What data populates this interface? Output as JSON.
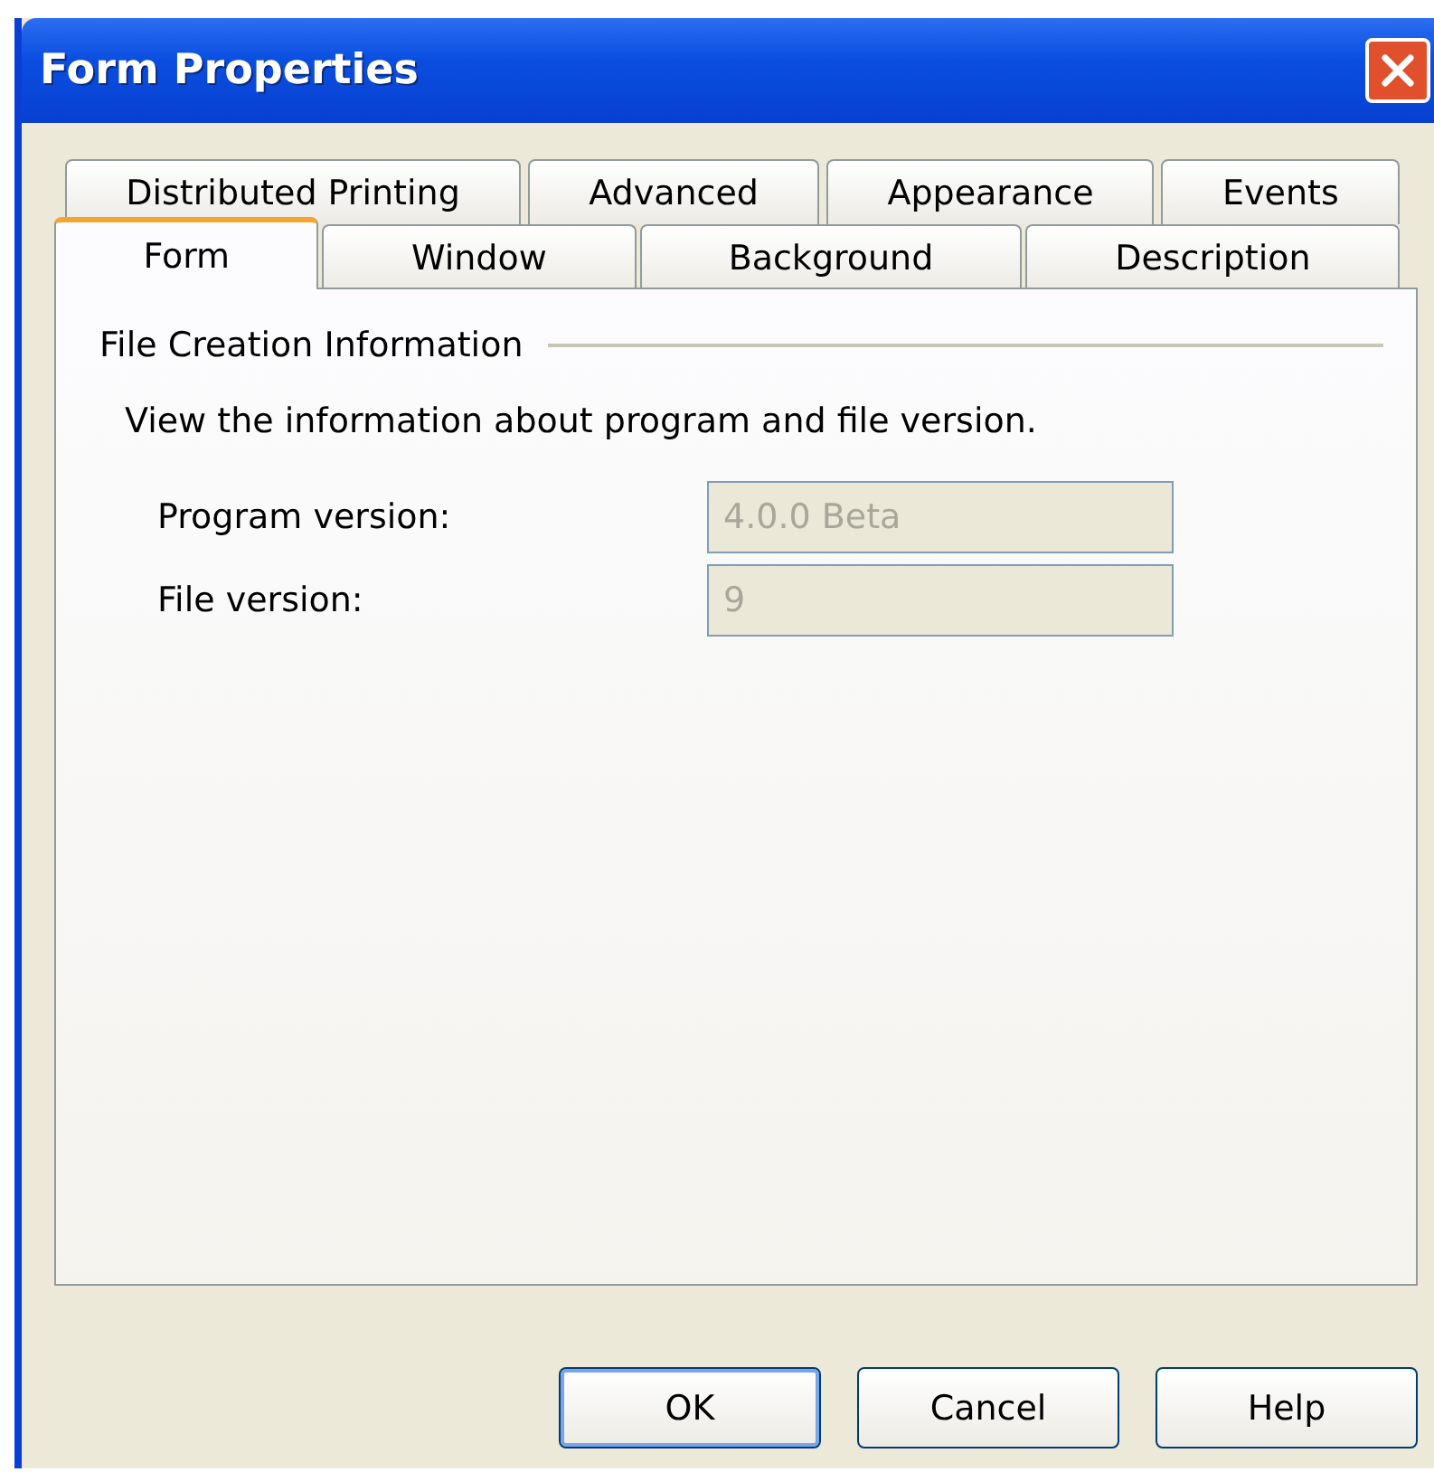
{
  "window": {
    "title": "Form Properties"
  },
  "tab_rows": [
    {
      "tabs": [
        {
          "label": "Distributed Printing",
          "selected": false
        },
        {
          "label": "Advanced",
          "selected": false
        },
        {
          "label": "Appearance",
          "selected": false
        },
        {
          "label": "Events",
          "selected": false
        }
      ]
    },
    {
      "tabs": [
        {
          "label": "Form",
          "selected": true
        },
        {
          "label": "Window",
          "selected": false
        },
        {
          "label": "Background",
          "selected": false
        },
        {
          "label": "Description",
          "selected": false
        }
      ]
    }
  ],
  "group": {
    "title": "File Creation Information",
    "description": "View the information about program and file version.",
    "fields": [
      {
        "label": "Program version:",
        "value": "4.0.0 Beta",
        "disabled": true
      },
      {
        "label": "File version:",
        "value": "9",
        "disabled": true
      }
    ]
  },
  "buttons": [
    {
      "label": "OK",
      "default": true
    },
    {
      "label": "Cancel",
      "default": false
    },
    {
      "label": "Help",
      "default": false
    }
  ]
}
